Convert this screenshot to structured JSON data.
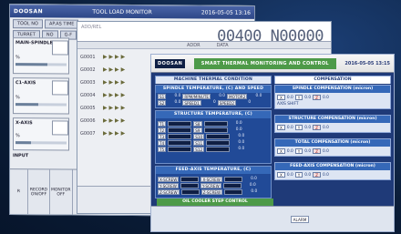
{
  "screen1": {
    "logo": "DOOSAN",
    "title": "TOOL LOAD MONITOR",
    "date": "2016-05-05 13:16",
    "tabs": [
      "TOOL NO",
      "AP.AS TIME",
      "TURRET",
      "NO",
      "G-F"
    ],
    "blocks": [
      {
        "label": "MAIN-SPINDLE",
        "unit": "%",
        "level": 0.62
      },
      {
        "label": "C1-AXIS",
        "unit": "%",
        "level": 0.45
      },
      {
        "label": "X-AXIS",
        "unit": "%",
        "level": 0.3
      }
    ],
    "input_label": "INPUT",
    "bottom": [
      "R",
      "RECORD ON/OFF",
      "MONITOR OFF"
    ]
  },
  "screen2": {
    "header_small": "ADD/REL",
    "big_number": "00400 N00000",
    "subhead": [
      "ADDR",
      "DATA"
    ],
    "labels": [
      "G0001",
      "G0002",
      "G0003",
      "G0004",
      "G0005",
      "G0006",
      "G0007"
    ]
  },
  "screen3": {
    "logo": "DOOSAN",
    "title": "SMART THERMAL MONITORING AND CONTROL",
    "date": "2016-05-05 13:15",
    "machine_header": "MACHINE THERMAL CONDITION",
    "spindle_header": "SPINDLE TEMPERATURE, (C) AND SPEED",
    "spindle_rows": [
      {
        "key": "S1",
        "v1": "0.0",
        "tag1": "RPM/MINUTE",
        "v2": "0.0",
        "tag2": "MOTOR2",
        "v3": "0.0"
      },
      {
        "key": "S2",
        "v1": "0.0",
        "tag1": "SPEED1",
        "v2": "0",
        "tag2": "SPEED2",
        "v3": "0"
      }
    ],
    "structure_header": "STRUCTURE TEMPERATURE, (C)",
    "structure_rows": [
      {
        "key": "T1",
        "mid": "S8",
        "val": "0.0"
      },
      {
        "key": "T2",
        "mid": "S9",
        "val": "0.0"
      },
      {
        "key": "T3",
        "mid": "S10",
        "val": "0.0"
      },
      {
        "key": "T4",
        "mid": "S11",
        "val": "0.0"
      },
      {
        "key": "T5",
        "mid": "S12",
        "val": "0.0"
      }
    ],
    "feed_header": "FEED-AXIS TEMPERATURE, (C)",
    "feed_rows": [
      {
        "key": "X-SCREW",
        "tag": "X-SCREW",
        "val": "0.0"
      },
      {
        "key": "Y-SCREW",
        "tag": "Y-SCREW",
        "val": "0.0"
      },
      {
        "key": "Z-SCREW",
        "tag": "Z-SCREW",
        "val": "0.0"
      }
    ],
    "oil_label": "OIL COOLER STEP CONTROL",
    "comp_header": "COMPENSATION",
    "spindle_comp": "SPINDLE COMPENSATION (micron)",
    "spindle_comp_items": [
      "X",
      "0.0",
      "Y",
      "0.0",
      "Z",
      "0.0"
    ],
    "axis_shift": "AXIS SHIFT",
    "structure_comp": "STRUCTURE COMPENSATION (micron)",
    "structure_comp_items": [
      "X",
      "0.0",
      "Y",
      "0.0",
      "Z",
      "0.0"
    ],
    "total_comp": "TOTAL COMPENSATION (micron)",
    "total_comp_items": [
      "X",
      "0.0",
      "Y",
      "0.0",
      "Z",
      "0.0"
    ],
    "feed_comp": "FEED-AXIS COMPENSATION (micron)",
    "feed_comp_items": [
      "X",
      "0.0",
      "Y",
      "0.0",
      "Z",
      "0.0"
    ],
    "alarm_label": "ALARM"
  },
  "colors": {
    "background": "#0b1e3a",
    "panel_blue": "#1f3a78",
    "green_title": "#4d9a48",
    "header_blue": "#3568b8"
  }
}
